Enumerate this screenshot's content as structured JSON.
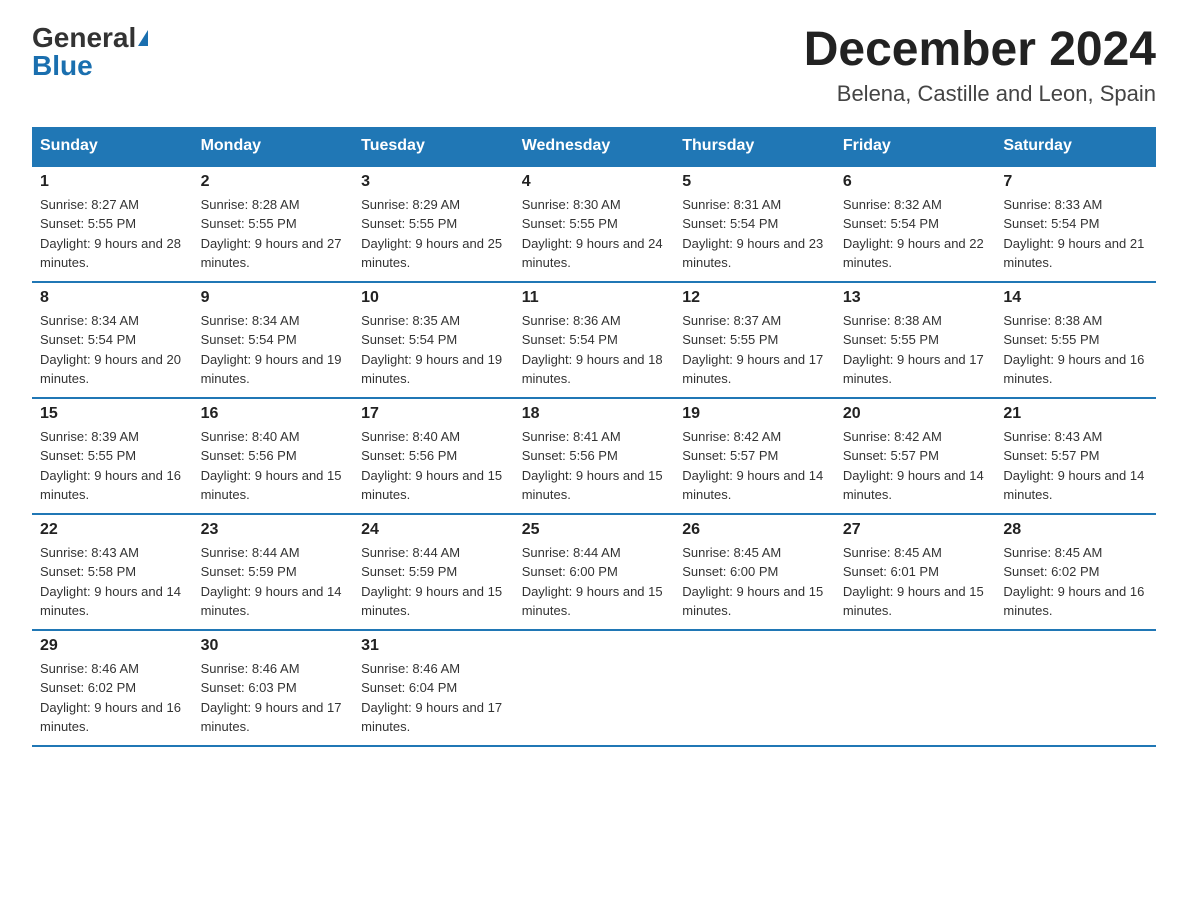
{
  "logo": {
    "general": "General",
    "blue": "Blue"
  },
  "title": "December 2024",
  "location": "Belena, Castille and Leon, Spain",
  "weekdays": [
    "Sunday",
    "Monday",
    "Tuesday",
    "Wednesday",
    "Thursday",
    "Friday",
    "Saturday"
  ],
  "weeks": [
    [
      {
        "day": "1",
        "sunrise": "Sunrise: 8:27 AM",
        "sunset": "Sunset: 5:55 PM",
        "daylight": "Daylight: 9 hours and 28 minutes."
      },
      {
        "day": "2",
        "sunrise": "Sunrise: 8:28 AM",
        "sunset": "Sunset: 5:55 PM",
        "daylight": "Daylight: 9 hours and 27 minutes."
      },
      {
        "day": "3",
        "sunrise": "Sunrise: 8:29 AM",
        "sunset": "Sunset: 5:55 PM",
        "daylight": "Daylight: 9 hours and 25 minutes."
      },
      {
        "day": "4",
        "sunrise": "Sunrise: 8:30 AM",
        "sunset": "Sunset: 5:55 PM",
        "daylight": "Daylight: 9 hours and 24 minutes."
      },
      {
        "day": "5",
        "sunrise": "Sunrise: 8:31 AM",
        "sunset": "Sunset: 5:54 PM",
        "daylight": "Daylight: 9 hours and 23 minutes."
      },
      {
        "day": "6",
        "sunrise": "Sunrise: 8:32 AM",
        "sunset": "Sunset: 5:54 PM",
        "daylight": "Daylight: 9 hours and 22 minutes."
      },
      {
        "day": "7",
        "sunrise": "Sunrise: 8:33 AM",
        "sunset": "Sunset: 5:54 PM",
        "daylight": "Daylight: 9 hours and 21 minutes."
      }
    ],
    [
      {
        "day": "8",
        "sunrise": "Sunrise: 8:34 AM",
        "sunset": "Sunset: 5:54 PM",
        "daylight": "Daylight: 9 hours and 20 minutes."
      },
      {
        "day": "9",
        "sunrise": "Sunrise: 8:34 AM",
        "sunset": "Sunset: 5:54 PM",
        "daylight": "Daylight: 9 hours and 19 minutes."
      },
      {
        "day": "10",
        "sunrise": "Sunrise: 8:35 AM",
        "sunset": "Sunset: 5:54 PM",
        "daylight": "Daylight: 9 hours and 19 minutes."
      },
      {
        "day": "11",
        "sunrise": "Sunrise: 8:36 AM",
        "sunset": "Sunset: 5:54 PM",
        "daylight": "Daylight: 9 hours and 18 minutes."
      },
      {
        "day": "12",
        "sunrise": "Sunrise: 8:37 AM",
        "sunset": "Sunset: 5:55 PM",
        "daylight": "Daylight: 9 hours and 17 minutes."
      },
      {
        "day": "13",
        "sunrise": "Sunrise: 8:38 AM",
        "sunset": "Sunset: 5:55 PM",
        "daylight": "Daylight: 9 hours and 17 minutes."
      },
      {
        "day": "14",
        "sunrise": "Sunrise: 8:38 AM",
        "sunset": "Sunset: 5:55 PM",
        "daylight": "Daylight: 9 hours and 16 minutes."
      }
    ],
    [
      {
        "day": "15",
        "sunrise": "Sunrise: 8:39 AM",
        "sunset": "Sunset: 5:55 PM",
        "daylight": "Daylight: 9 hours and 16 minutes."
      },
      {
        "day": "16",
        "sunrise": "Sunrise: 8:40 AM",
        "sunset": "Sunset: 5:56 PM",
        "daylight": "Daylight: 9 hours and 15 minutes."
      },
      {
        "day": "17",
        "sunrise": "Sunrise: 8:40 AM",
        "sunset": "Sunset: 5:56 PM",
        "daylight": "Daylight: 9 hours and 15 minutes."
      },
      {
        "day": "18",
        "sunrise": "Sunrise: 8:41 AM",
        "sunset": "Sunset: 5:56 PM",
        "daylight": "Daylight: 9 hours and 15 minutes."
      },
      {
        "day": "19",
        "sunrise": "Sunrise: 8:42 AM",
        "sunset": "Sunset: 5:57 PM",
        "daylight": "Daylight: 9 hours and 14 minutes."
      },
      {
        "day": "20",
        "sunrise": "Sunrise: 8:42 AM",
        "sunset": "Sunset: 5:57 PM",
        "daylight": "Daylight: 9 hours and 14 minutes."
      },
      {
        "day": "21",
        "sunrise": "Sunrise: 8:43 AM",
        "sunset": "Sunset: 5:57 PM",
        "daylight": "Daylight: 9 hours and 14 minutes."
      }
    ],
    [
      {
        "day": "22",
        "sunrise": "Sunrise: 8:43 AM",
        "sunset": "Sunset: 5:58 PM",
        "daylight": "Daylight: 9 hours and 14 minutes."
      },
      {
        "day": "23",
        "sunrise": "Sunrise: 8:44 AM",
        "sunset": "Sunset: 5:59 PM",
        "daylight": "Daylight: 9 hours and 14 minutes."
      },
      {
        "day": "24",
        "sunrise": "Sunrise: 8:44 AM",
        "sunset": "Sunset: 5:59 PM",
        "daylight": "Daylight: 9 hours and 15 minutes."
      },
      {
        "day": "25",
        "sunrise": "Sunrise: 8:44 AM",
        "sunset": "Sunset: 6:00 PM",
        "daylight": "Daylight: 9 hours and 15 minutes."
      },
      {
        "day": "26",
        "sunrise": "Sunrise: 8:45 AM",
        "sunset": "Sunset: 6:00 PM",
        "daylight": "Daylight: 9 hours and 15 minutes."
      },
      {
        "day": "27",
        "sunrise": "Sunrise: 8:45 AM",
        "sunset": "Sunset: 6:01 PM",
        "daylight": "Daylight: 9 hours and 15 minutes."
      },
      {
        "day": "28",
        "sunrise": "Sunrise: 8:45 AM",
        "sunset": "Sunset: 6:02 PM",
        "daylight": "Daylight: 9 hours and 16 minutes."
      }
    ],
    [
      {
        "day": "29",
        "sunrise": "Sunrise: 8:46 AM",
        "sunset": "Sunset: 6:02 PM",
        "daylight": "Daylight: 9 hours and 16 minutes."
      },
      {
        "day": "30",
        "sunrise": "Sunrise: 8:46 AM",
        "sunset": "Sunset: 6:03 PM",
        "daylight": "Daylight: 9 hours and 17 minutes."
      },
      {
        "day": "31",
        "sunrise": "Sunrise: 8:46 AM",
        "sunset": "Sunset: 6:04 PM",
        "daylight": "Daylight: 9 hours and 17 minutes."
      },
      null,
      null,
      null,
      null
    ]
  ]
}
